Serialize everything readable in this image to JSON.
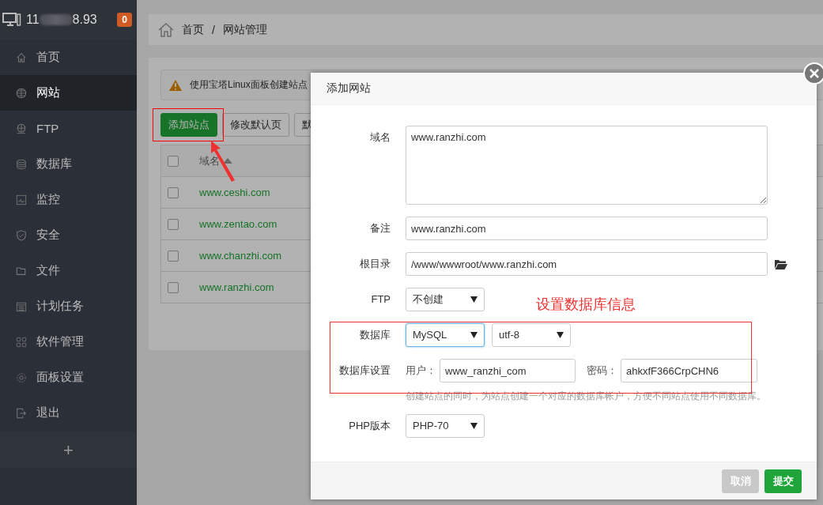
{
  "sidebar": {
    "host_start": "11",
    "host_end": "8.93",
    "badge": "0",
    "add": "+",
    "items": [
      {
        "label": "首页",
        "selected": false
      },
      {
        "label": "网站",
        "selected": true
      },
      {
        "label": "FTP",
        "selected": false
      },
      {
        "label": "数据库",
        "selected": false
      },
      {
        "label": "监控",
        "selected": false
      },
      {
        "label": "安全",
        "selected": false
      },
      {
        "label": "文件",
        "selected": false
      },
      {
        "label": "计划任务",
        "selected": false
      },
      {
        "label": "软件管理",
        "selected": false
      },
      {
        "label": "面板设置",
        "selected": false
      },
      {
        "label": "退出",
        "selected": false
      }
    ]
  },
  "breadcrumb": {
    "items": [
      "首页",
      "网站管理"
    ],
    "separator": "/"
  },
  "alert": {
    "text": "使用宝塔Linux面板创建站点"
  },
  "toolbar": [
    {
      "label": "添加站点",
      "kind": "primary"
    },
    {
      "label": "修改默认页",
      "kind": "default"
    },
    {
      "label": "默",
      "kind": "default"
    }
  ],
  "table": {
    "column": "域名",
    "all_checked": false,
    "rows": [
      {
        "domain": "www.ceshi.com",
        "checked": false
      },
      {
        "domain": "www.zentao.com",
        "checked": false
      },
      {
        "domain": "www.chanzhi.com",
        "checked": false
      },
      {
        "domain": "www.ranzhi.com",
        "checked": false
      }
    ]
  },
  "modal": {
    "title": "添加网站",
    "form": [
      {
        "kind": "textarea",
        "label": "域名",
        "value": "www.ranzhi.com"
      },
      {
        "kind": "input",
        "label": "备注",
        "value": "www.ranzhi.com"
      },
      {
        "kind": "path",
        "label": "根目录",
        "value": "/www/wwwroot/www.ranzhi.com"
      },
      {
        "kind": "select",
        "label": "FTP",
        "value": "不创建"
      },
      {
        "kind": "selects",
        "label": "数据库",
        "selects": [
          {
            "value": "MySQL",
            "focused": true
          },
          {
            "value": "utf-8",
            "focused": false
          }
        ]
      },
      {
        "kind": "credentials",
        "label": "数据库设置",
        "user_label": "用户：",
        "user": "www_ranzhi_com",
        "password_label": "密码：",
        "password": "ahkxfF366CrpCHN6"
      },
      {
        "kind": "hint",
        "text": "创建站点的同时，为站点创建一个对应的数据库帐户，方便不同站点使用不同数据库。"
      },
      {
        "kind": "select",
        "label": "PHP版本",
        "value": "PHP-70"
      }
    ],
    "buttons": [
      {
        "label": "取消",
        "kind": "disabled"
      },
      {
        "label": "提交",
        "kind": "primary"
      }
    ]
  },
  "annotation": {
    "text": "设置数据库信息"
  }
}
